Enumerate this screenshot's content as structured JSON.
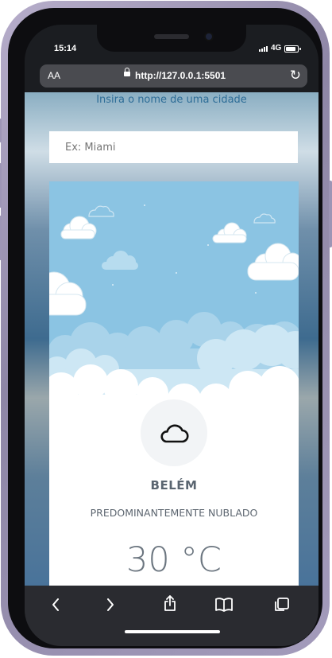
{
  "status": {
    "time": "15:14",
    "network": "4G",
    "battery_level": 0.85
  },
  "browser": {
    "text_size_label": "AA",
    "url": "http://127.0.0.1:5501"
  },
  "page": {
    "label": "Insira o nome de uma cidade",
    "input_placeholder": "Ex: Miami",
    "input_value": ""
  },
  "weather": {
    "icon": "cloud-icon",
    "city": "BELÉM",
    "condition": "PREDOMINANTEMENTE NUBLADO",
    "temperature": "30 °C"
  },
  "colors": {
    "label": "#2e6d97",
    "sky": "#8bc4e3",
    "text_muted": "#5a6570"
  },
  "toolbar": {
    "icons": [
      "back-icon",
      "forward-icon",
      "share-icon",
      "bookmarks-icon",
      "tabs-icon"
    ]
  }
}
